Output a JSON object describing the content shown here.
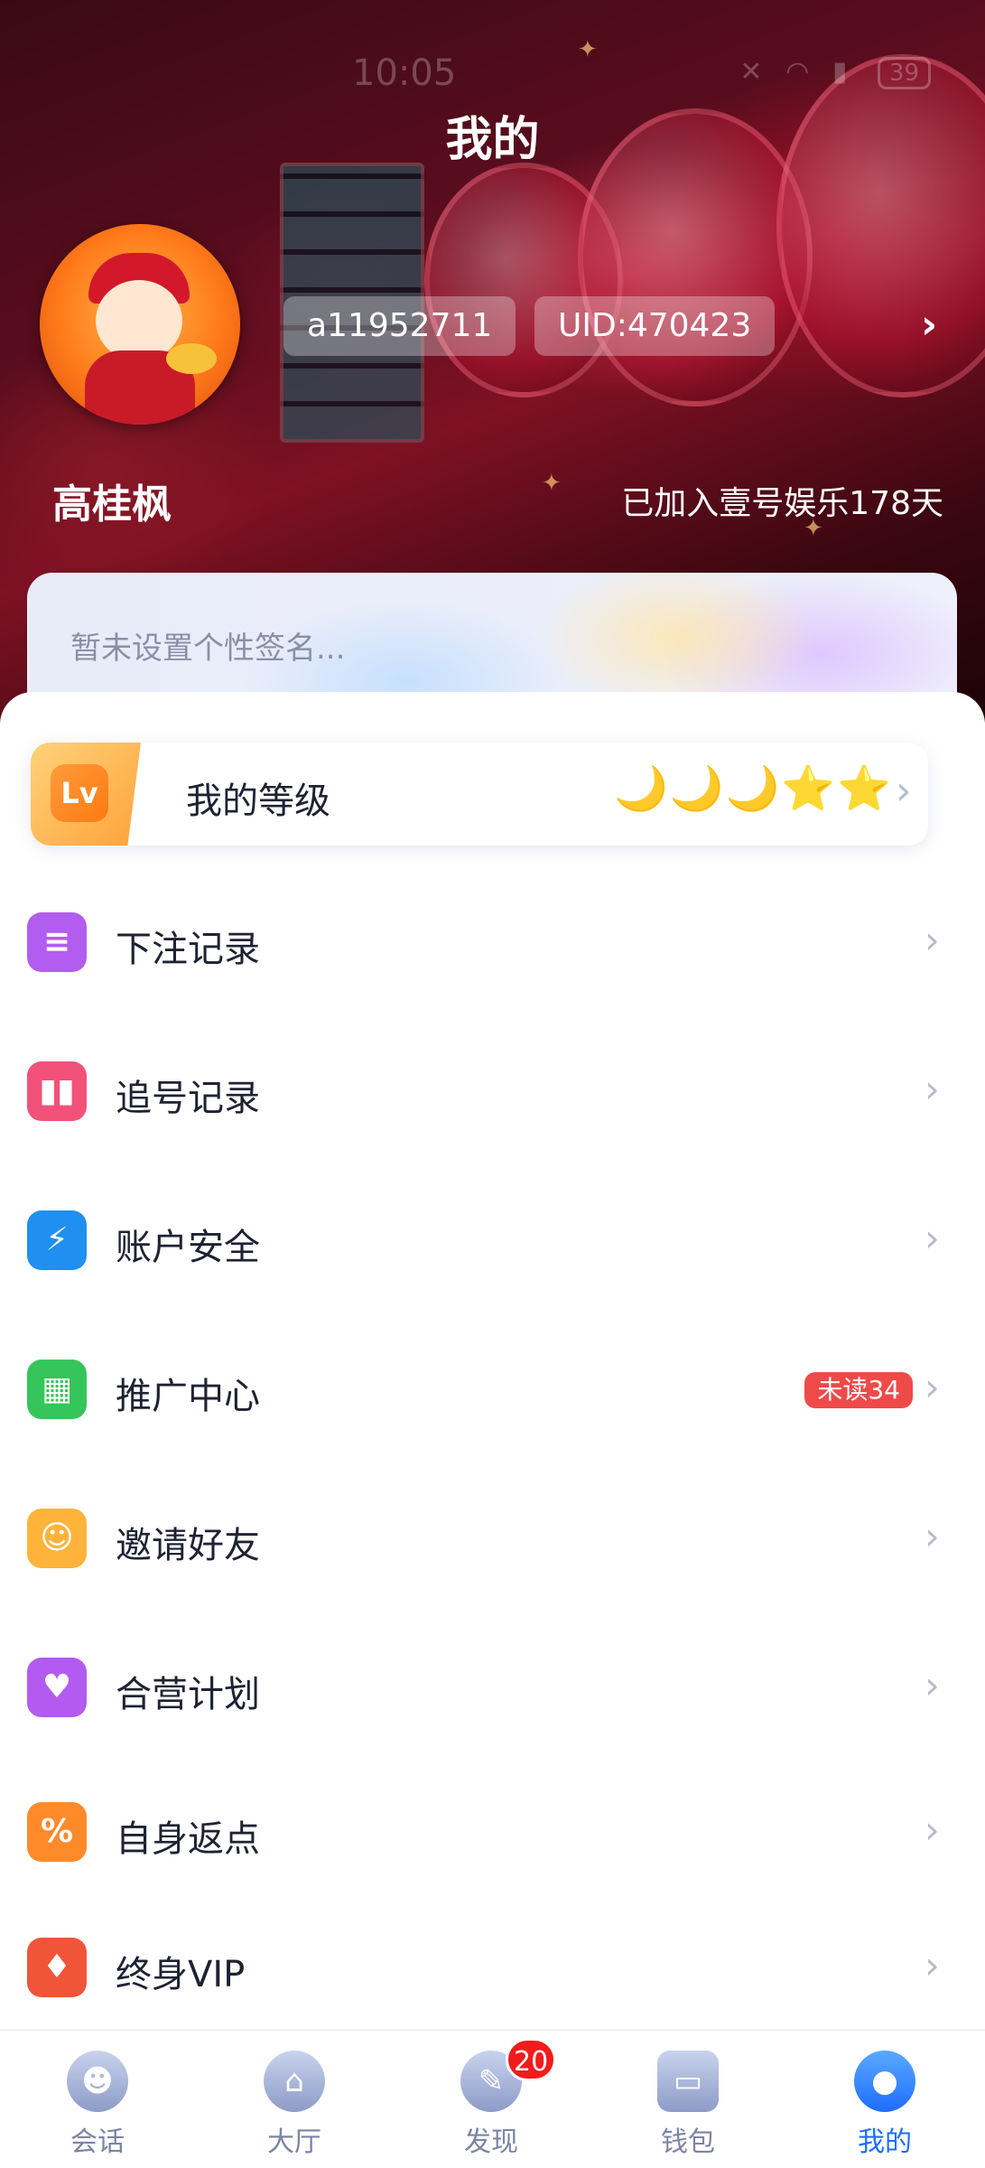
{
  "status_bar": {
    "time": "10:05",
    "battery": "39"
  },
  "header": {
    "title": "我的"
  },
  "profile": {
    "username": "a11952711",
    "uid": "UID:470423",
    "nickname": "高桂枫",
    "joined": "已加入壹号娱乐178天"
  },
  "signature": {
    "placeholder": "暂未设置个性签名..."
  },
  "level": {
    "badge": "Lv",
    "label": "我的等级",
    "marks": "🌙🌙🌙⭐⭐"
  },
  "menu": [
    {
      "label": "下注记录",
      "icon": "bet-record-icon",
      "color": "#b25cf0"
    },
    {
      "label": "追号记录",
      "icon": "chase-record-icon",
      "color": "#f2517a"
    },
    {
      "label": "账户安全",
      "icon": "shield-icon",
      "color": "#1f8ff0"
    },
    {
      "label": "推广中心",
      "icon": "qr-code-icon",
      "color": "#35c55a",
      "badge": "未读34"
    },
    {
      "label": "邀请好友",
      "icon": "invite-icon",
      "color": "#ffb33a"
    },
    {
      "label": "合营计划",
      "icon": "partner-icon",
      "color": "#b35af0"
    },
    {
      "label": "自身返点",
      "icon": "percent-icon",
      "color": "#ff8a2a"
    },
    {
      "label": "终身VIP",
      "icon": "vip-icon",
      "color": "#f0553a"
    }
  ],
  "tabbar": [
    {
      "label": "会话",
      "icon": "chat-icon"
    },
    {
      "label": "大厅",
      "icon": "home-icon"
    },
    {
      "label": "发现",
      "icon": "discover-icon",
      "badge": "20"
    },
    {
      "label": "钱包",
      "icon": "wallet-icon"
    },
    {
      "label": "我的",
      "icon": "profile-icon",
      "active": true
    }
  ]
}
